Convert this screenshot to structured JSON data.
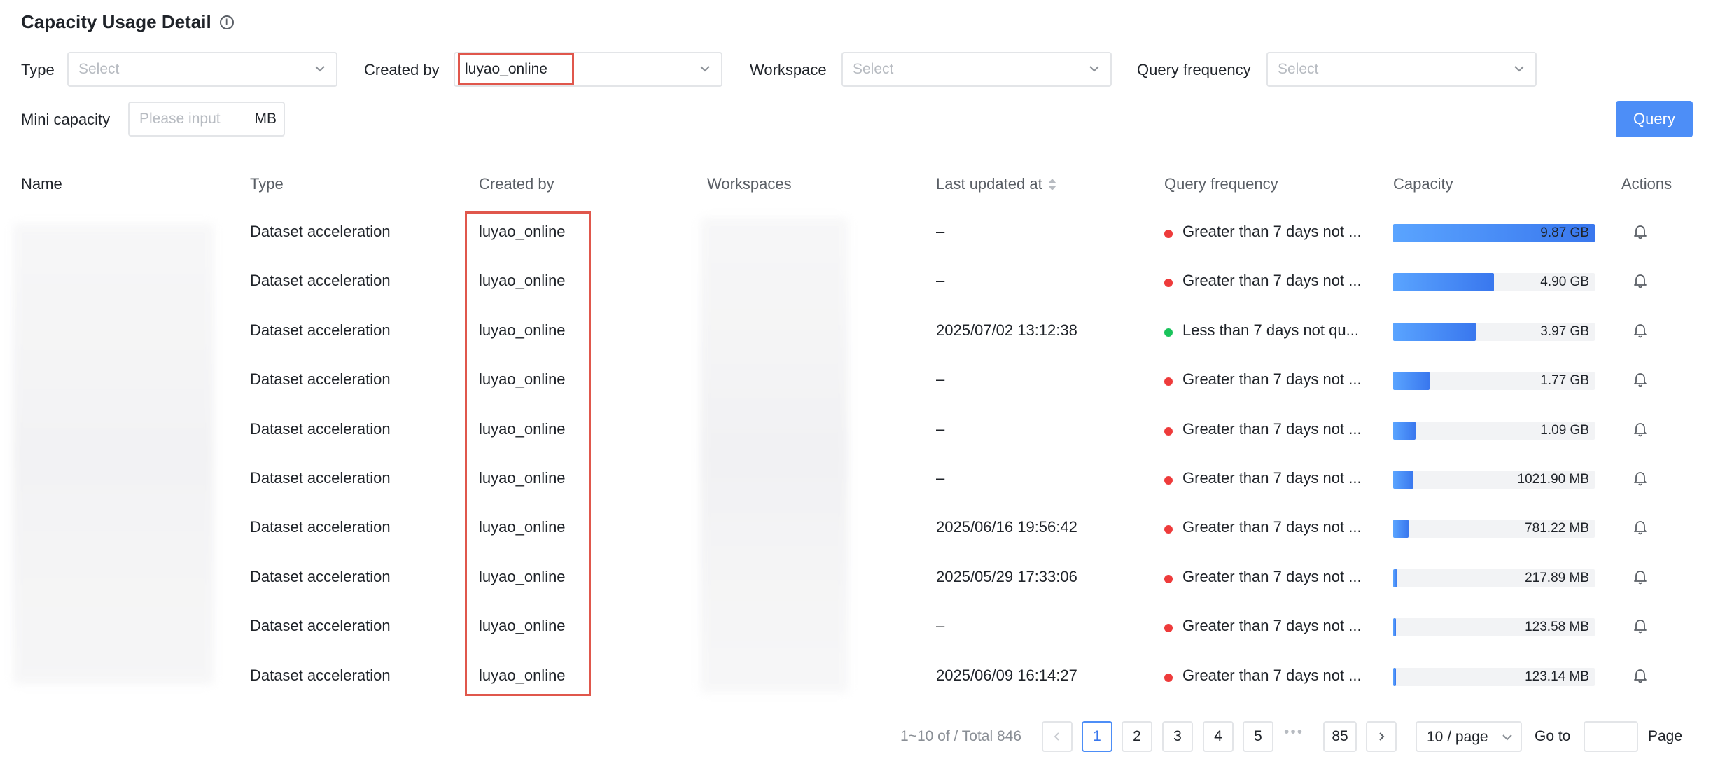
{
  "title": "Capacity Usage Detail",
  "filters": {
    "type_label": "Type",
    "type_placeholder": "Select",
    "created_by_label": "Created by",
    "created_by_value": "luyao_online",
    "workspace_label": "Workspace",
    "workspace_placeholder": "Select",
    "query_freq_label": "Query frequency",
    "query_freq_placeholder": "Select",
    "mini_capacity_label": "Mini capacity",
    "mini_capacity_placeholder": "Please input",
    "mini_capacity_unit": "MB",
    "query_button": "Query"
  },
  "table": {
    "headers": {
      "name": "Name",
      "type": "Type",
      "created_by": "Created by",
      "workspaces": "Workspaces",
      "last_updated": "Last updated at",
      "query_frequency": "Query frequency",
      "capacity": "Capacity",
      "actions": "Actions"
    },
    "rows": [
      {
        "type": "Dataset acceleration",
        "created_by": "luyao_online",
        "last_updated": "–",
        "freq_text": "Greater than 7 days not ...",
        "freq_status": "red",
        "capacity_text": "9.87 GB",
        "capacity_ratio": 1.0
      },
      {
        "type": "Dataset acceleration",
        "created_by": "luyao_online",
        "last_updated": "–",
        "freq_text": "Greater than 7 days not ...",
        "freq_status": "red",
        "capacity_text": "4.90 GB",
        "capacity_ratio": 0.5
      },
      {
        "type": "Dataset acceleration",
        "created_by": "luyao_online",
        "last_updated": "2025/07/02 13:12:38",
        "freq_text": "Less than 7 days not qu...",
        "freq_status": "green",
        "capacity_text": "3.97 GB",
        "capacity_ratio": 0.41
      },
      {
        "type": "Dataset acceleration",
        "created_by": "luyao_online",
        "last_updated": "–",
        "freq_text": "Greater than 7 days not ...",
        "freq_status": "red",
        "capacity_text": "1.77 GB",
        "capacity_ratio": 0.18
      },
      {
        "type": "Dataset acceleration",
        "created_by": "luyao_online",
        "last_updated": "–",
        "freq_text": "Greater than 7 days not ...",
        "freq_status": "red",
        "capacity_text": "1.09 GB",
        "capacity_ratio": 0.11
      },
      {
        "type": "Dataset acceleration",
        "created_by": "luyao_online",
        "last_updated": "–",
        "freq_text": "Greater than 7 days not ...",
        "freq_status": "red",
        "capacity_text": "1021.90 MB",
        "capacity_ratio": 0.1
      },
      {
        "type": "Dataset acceleration",
        "created_by": "luyao_online",
        "last_updated": "2025/06/16 19:56:42",
        "freq_text": "Greater than 7 days not ...",
        "freq_status": "red",
        "capacity_text": "781.22 MB",
        "capacity_ratio": 0.077
      },
      {
        "type": "Dataset acceleration",
        "created_by": "luyao_online",
        "last_updated": "2025/05/29 17:33:06",
        "freq_text": "Greater than 7 days not ...",
        "freq_status": "red",
        "capacity_text": "217.89 MB",
        "capacity_ratio": 0.022
      },
      {
        "type": "Dataset acceleration",
        "created_by": "luyao_online",
        "last_updated": "–",
        "freq_text": "Greater than 7 days not ...",
        "freq_status": "red",
        "capacity_text": "123.58 MB",
        "capacity_ratio": 0.012
      },
      {
        "type": "Dataset acceleration",
        "created_by": "luyao_online",
        "last_updated": "2025/06/09 16:14:27",
        "freq_text": "Greater than 7 days not ...",
        "freq_status": "red",
        "capacity_text": "123.14 MB",
        "capacity_ratio": 0.012
      }
    ]
  },
  "colors": {
    "accent": "#4d8ef7",
    "status_red": "#ee3b3b",
    "status_green": "#19c35b",
    "highlight": "#e0574c"
  },
  "pagination": {
    "total_text": "1~10 of / Total 846",
    "pages": [
      "1",
      "2",
      "3",
      "4",
      "5"
    ],
    "ellipsis": "•••",
    "last_page": "85",
    "current_page": "1",
    "page_size": "10 / page",
    "goto_label": "Go to",
    "page_label": "Page"
  },
  "icons": {
    "info": "info-icon",
    "chevron": "chevron-down-icon",
    "sort": "sort-icon",
    "bell": "bell-icon",
    "prev": "chevron-left-icon",
    "next": "chevron-right-icon"
  }
}
